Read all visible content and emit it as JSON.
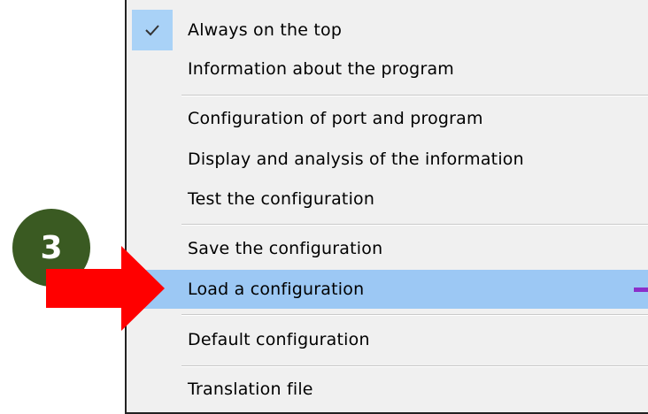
{
  "menu": {
    "items": [
      {
        "label": "Always on the top",
        "checked": true
      },
      {
        "label": "Information about the program"
      },
      {
        "label": "Configuration of port and program"
      },
      {
        "label": "Display and analysis of the information"
      },
      {
        "label": "Test the configuration"
      },
      {
        "label": "Save the configuration"
      },
      {
        "label": "Load a configuration",
        "highlighted": true
      },
      {
        "label": "Default configuration"
      },
      {
        "label": "Translation file"
      }
    ]
  },
  "annotation": {
    "step_number": "3",
    "badge_color": "#3a5a22",
    "arrow_color": "#ff0000",
    "highlight_color": "#9cc8f4",
    "submenu_mark_color": "#8b2fc9"
  },
  "icons": {
    "checkmark": "check-icon",
    "arrow": "right-arrow-icon"
  }
}
